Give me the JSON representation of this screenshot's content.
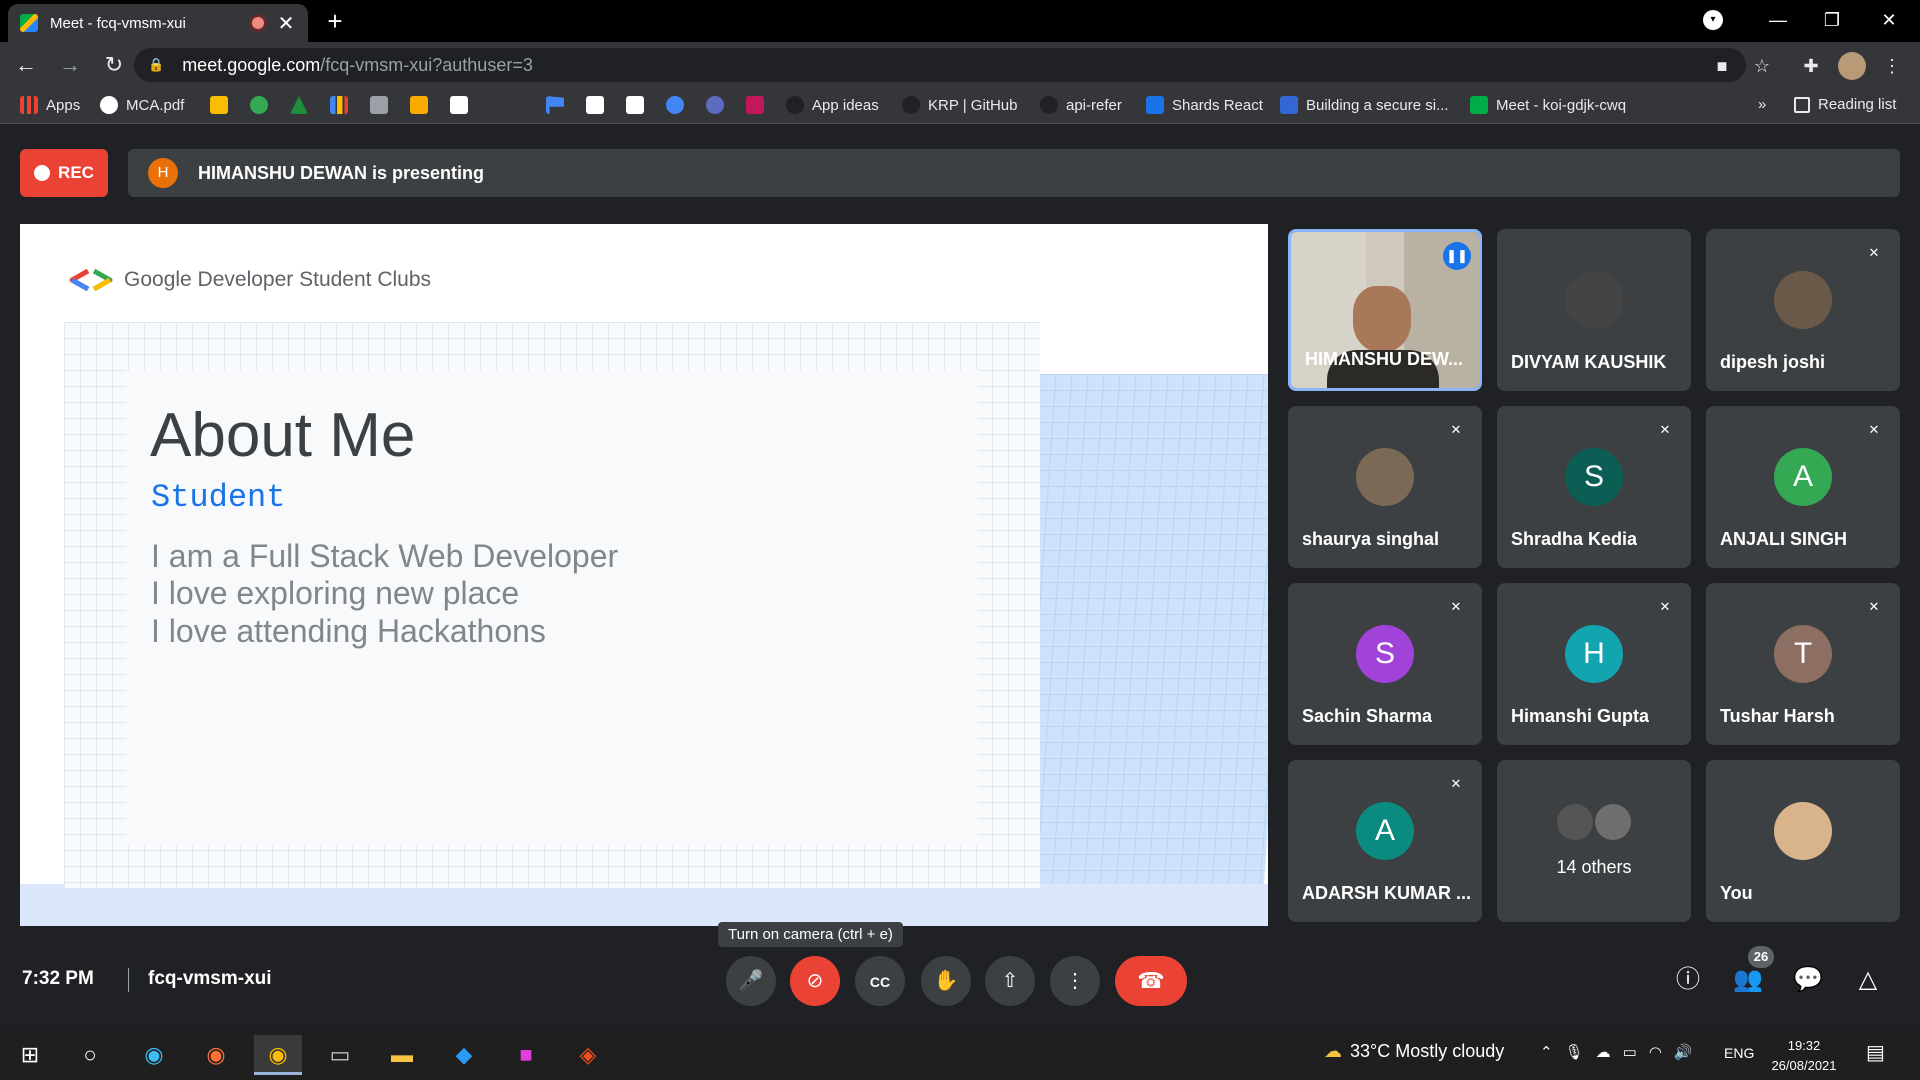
{
  "browser": {
    "tab_title": "Meet - fcq-vmsm-xui",
    "tab_close": "✕",
    "new_tab": "+",
    "url_host": "meet.google.com",
    "url_path": "/fcq-vmsm-xui?authuser=3"
  },
  "bookmarks": [
    {
      "label": "Apps",
      "icon_color": "#ea4335"
    },
    {
      "label": "MCA.pdf",
      "icon_color": "#ffffff"
    },
    {
      "label": "",
      "icon_color": "#fbbc04"
    },
    {
      "label": "",
      "icon_color": "#34a853"
    },
    {
      "label": "",
      "icon_color": "#1e8e3e"
    },
    {
      "label": "",
      "icon_color": "#4285f4"
    },
    {
      "label": "",
      "icon_color": "#9aa0a6"
    },
    {
      "label": "",
      "icon_color": "#f9ab00"
    },
    {
      "label": "",
      "icon_color": "#202124"
    },
    {
      "label": "",
      "icon_color": "#4285f4"
    },
    {
      "label": "",
      "icon_color": "#ffffff"
    },
    {
      "label": "",
      "icon_color": "#ffffff"
    },
    {
      "label": "",
      "icon_color": "#4285f4"
    },
    {
      "label": "",
      "icon_color": "#5c6bc0"
    },
    {
      "label": "",
      "icon_color": "#c2185b"
    },
    {
      "label": "App ideas",
      "icon_color": "#202124"
    },
    {
      "label": "KRP | GitHub",
      "icon_color": "#202124"
    },
    {
      "label": "api-refer",
      "icon_color": "#202124"
    },
    {
      "label": "Shards React",
      "icon_color": "#1a73e8"
    },
    {
      "label": "Building a secure si...",
      "icon_color": "#3367d6"
    },
    {
      "label": "Meet - koi-gdjk-cwq",
      "icon_color": "#00ac47"
    }
  ],
  "bookmarks_overflow": "»",
  "reading_list": "Reading list",
  "meet": {
    "rec_label": "REC",
    "presenter_initial": "H",
    "presenting_text": "HIMANSHU DEWAN is presenting",
    "slide": {
      "brand": "Google Developer Student Clubs",
      "title": "About Me",
      "subtitle": "Student",
      "lines": [
        "I am a Full Stack Web Developer",
        "I love exploring new place",
        "I love attending Hackathons"
      ]
    },
    "participants": [
      {
        "name": "HIMANSHU DEW...",
        "initial": "",
        "color": ""
      },
      {
        "name": "DIVYAM KAUSHIK",
        "initial": "",
        "color": "#444"
      },
      {
        "name": "dipesh joshi",
        "initial": "",
        "color": "#6b5a4a"
      },
      {
        "name": "shaurya singhal",
        "initial": "",
        "color": "#7a6a55"
      },
      {
        "name": "Shradha Kedia",
        "initial": "S",
        "color": "#0b5e54"
      },
      {
        "name": "ANJALI SINGH",
        "initial": "A",
        "color": "#34a853"
      },
      {
        "name": "Sachin Sharma",
        "initial": "S",
        "color": "#a142d8"
      },
      {
        "name": "Himanshi Gupta",
        "initial": "H",
        "color": "#12a4af"
      },
      {
        "name": "Tushar Harsh",
        "initial": "T",
        "color": "#8d6e63"
      },
      {
        "name": "ADARSH KUMAR ...",
        "initial": "A",
        "color": "#0b8a7f"
      },
      {
        "name": "14 others",
        "initial": "",
        "color": ""
      },
      {
        "name": "You",
        "initial": "",
        "color": "#d9b48a"
      }
    ],
    "time": "7:32 PM",
    "meeting_code": "fcq-vmsm-xui",
    "tooltip": "Turn on camera (ctrl + e)",
    "people_count": "26"
  },
  "taskbar": {
    "weather": "33°C  Mostly cloudy",
    "language": "ENG",
    "time": "19:32",
    "date": "26/08/2021"
  }
}
